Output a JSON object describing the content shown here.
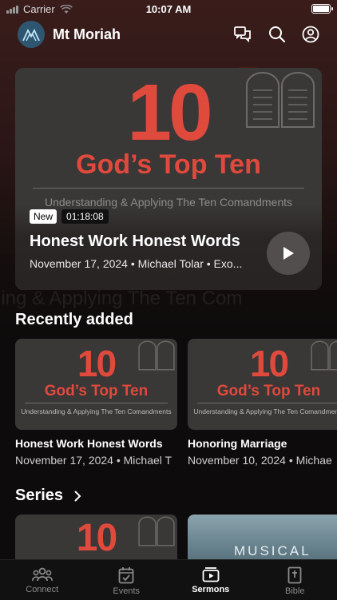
{
  "status_bar": {
    "carrier": "Carrier",
    "time": "10:07 AM"
  },
  "header": {
    "title": "Mt Moriah",
    "icons": [
      "chat-icon",
      "search-icon",
      "account-icon"
    ]
  },
  "featured": {
    "series_number": "10",
    "series_title": "God’s Top Ten",
    "series_subtitle": "Understanding & Applying The Ten Comandments",
    "badge": "New",
    "duration": "01:18:08",
    "title": "Honest Work Honest Words",
    "meta": "November 17, 2024 • Michael Tolar • Exo..."
  },
  "background_text": "rding & Applying The Ten Com",
  "recent": {
    "heading": "Recently added",
    "items": [
      {
        "number": "10",
        "series": "God’s Top Ten",
        "subtitle": "Understanding & Applying The Ten Comandments",
        "title": "Honest Work Honest Words",
        "meta": "November 17, 2024 • Michael T"
      },
      {
        "number": "10",
        "series": "God’s Top Ten",
        "subtitle": "Understanding & Applying The Ten Comandments",
        "title": "Honoring Marriage",
        "meta": "November 10, 2024 • Michae"
      }
    ]
  },
  "series": {
    "heading": "Series",
    "items": [
      {
        "number": "10"
      },
      {
        "text": "MUSICAL"
      }
    ]
  },
  "tabs": [
    {
      "label": "Connect",
      "icon": "people-icon",
      "active": false
    },
    {
      "label": "Events",
      "icon": "calendar-icon",
      "active": false
    },
    {
      "label": "Sermons",
      "icon": "play-square-icon",
      "active": true
    },
    {
      "label": "Bible",
      "icon": "bible-icon",
      "active": false
    }
  ],
  "colors": {
    "accent_red": "#e04a3c",
    "logo_blue": "#2e5670"
  }
}
